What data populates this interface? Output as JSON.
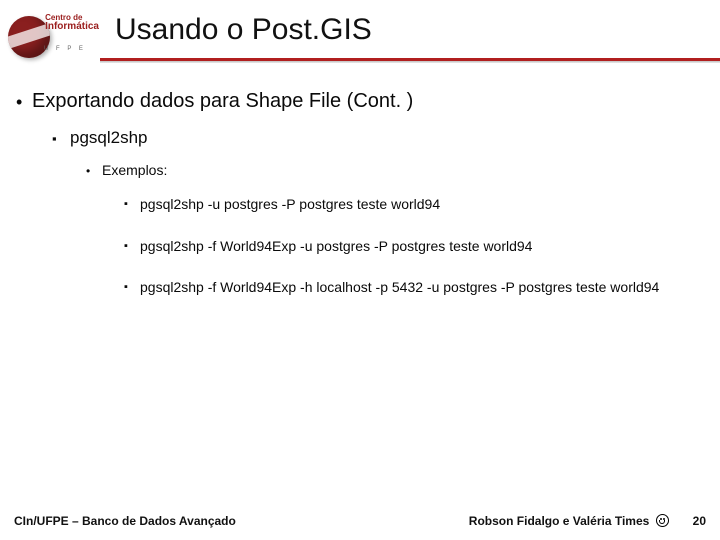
{
  "logo": {
    "line1": "Centro de",
    "line2": "Informática",
    "sub": "U F P E"
  },
  "title": "Usando o Post.GIS",
  "list": {
    "lvl1": "Exportando dados para Shape File (Cont. )",
    "lvl2": "pgsql2shp",
    "lvl3": "Exemplos:",
    "examples": [
      "pgsql2shp -u postgres -P postgres teste world94",
      "pgsql2shp -f World94Exp -u postgres -P postgres teste world94",
      "pgsql2shp -f World94Exp -h localhost -p 5432 -u postgres -P postgres teste world94"
    ]
  },
  "footer": {
    "left": "CIn/UFPE – Banco de Dados Avançado",
    "right": "Robson Fidalgo e Valéria Times",
    "page": "20"
  }
}
